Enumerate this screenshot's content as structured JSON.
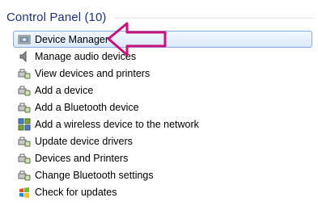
{
  "group": {
    "title": "Control Panel (10)"
  },
  "items": [
    {
      "label": "Device Manager",
      "icon": "device-manager-icon",
      "selected": true
    },
    {
      "label": "Manage audio devices",
      "icon": "speaker-icon",
      "selected": false
    },
    {
      "label": "View devices and printers",
      "icon": "devices-printers-icon",
      "selected": false
    },
    {
      "label": "Add a device",
      "icon": "devices-printers-icon",
      "selected": false
    },
    {
      "label": "Add a Bluetooth device",
      "icon": "devices-printers-icon",
      "selected": false
    },
    {
      "label": "Add a wireless device to the network",
      "icon": "network-icon",
      "selected": false
    },
    {
      "label": "Update device drivers",
      "icon": "devices-printers-icon",
      "selected": false
    },
    {
      "label": "Devices and Printers",
      "icon": "devices-printers-icon",
      "selected": false
    },
    {
      "label": "Change Bluetooth settings",
      "icon": "devices-printers-icon",
      "selected": false
    },
    {
      "label": "Check for updates",
      "icon": "windows-update-icon",
      "selected": false
    }
  ],
  "colors": {
    "header_text": "#1e3287",
    "selection_border": "#84acdd",
    "annotation_arrow": "#c8127e"
  }
}
